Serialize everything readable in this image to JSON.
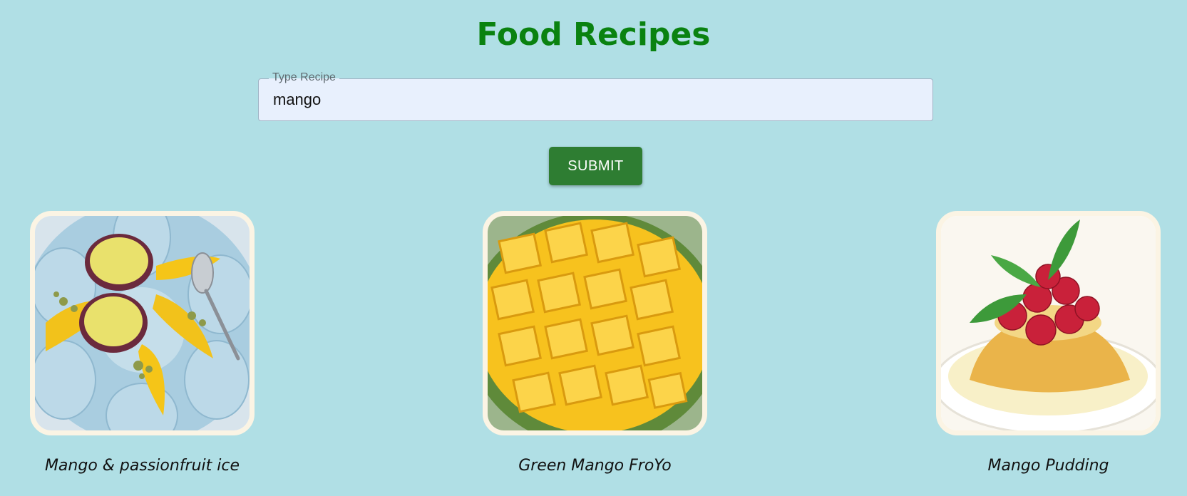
{
  "header": {
    "title": "Food Recipes"
  },
  "search": {
    "label": "Type Recipe",
    "value": "mango",
    "submit_label": "SUBMIT"
  },
  "colors": {
    "background": "#b0dfe5",
    "title": "#0a8210",
    "button": "#2e7d32",
    "card_border": "#fbf4e4"
  },
  "recipes": [
    {
      "name": "Mango & passionfruit ice",
      "image_icon": "mango-passionfruit-ice-photo"
    },
    {
      "name": "Green Mango FroYo",
      "image_icon": "cut-mango-photo"
    },
    {
      "name": "Mango Pudding",
      "image_icon": "mango-pudding-photo"
    }
  ]
}
